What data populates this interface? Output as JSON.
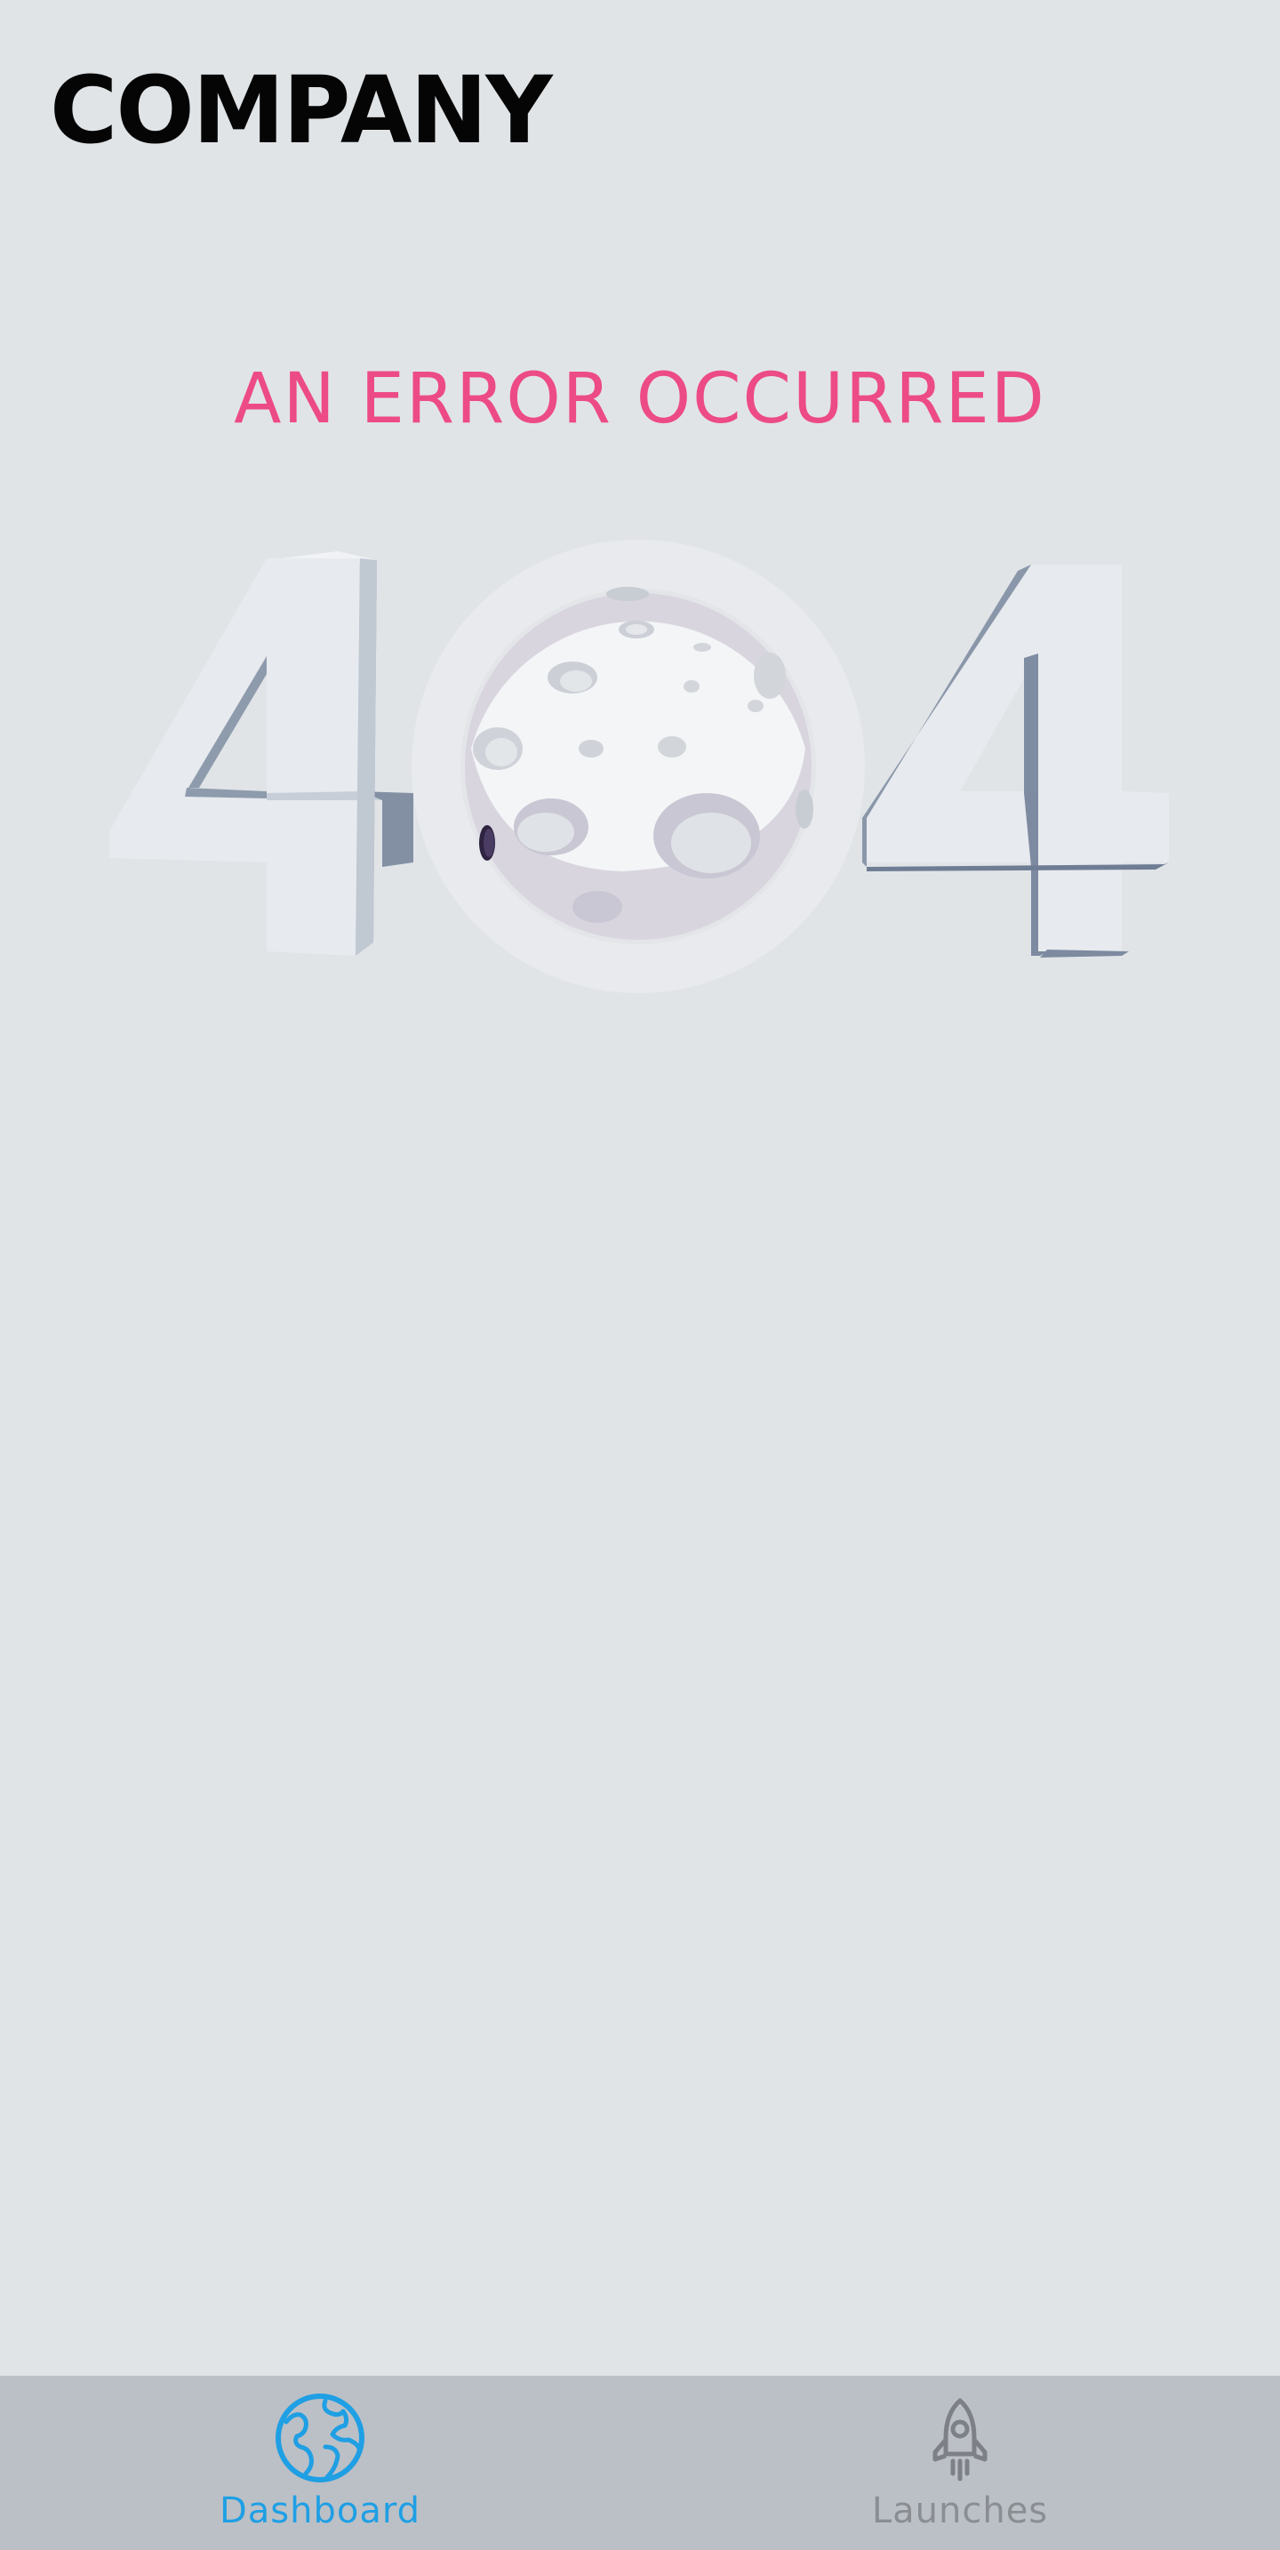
{
  "header": {
    "brand": "COMPANY"
  },
  "error": {
    "title": "AN ERROR OCCURRED",
    "code_left": "4",
    "code_right": "4",
    "illustration_icon": "moon-icon"
  },
  "bottom_nav": {
    "items": [
      {
        "label": "Dashboard",
        "icon": "globe-icon",
        "active": true
      },
      {
        "label": "Launches",
        "icon": "rocket-icon",
        "active": false
      }
    ]
  },
  "colors": {
    "background": "#e1e4e7",
    "accent_pink": "#ec4b86",
    "nav_background": "#bbc0c6",
    "nav_active": "#1f9fe4",
    "nav_inactive": "#8a8e93"
  }
}
